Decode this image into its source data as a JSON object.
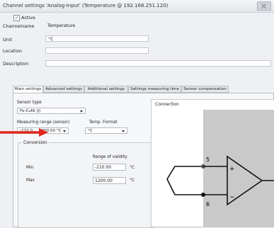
{
  "window": {
    "title": "Channel settings 'Analog-Input' (Temperature @ 192.168.251.120)",
    "active_label": "Active",
    "active_checked": true
  },
  "fields": {
    "channel_name_label": "Channelname",
    "channel_name_value": "Temperature",
    "unit_label": "Unit",
    "unit_value": "°C",
    "location_label": "Location",
    "location_value": "",
    "description_label": "Description",
    "description_value": ""
  },
  "tabs": [
    {
      "label": "Main settings",
      "active": true
    },
    {
      "label": "Advanced settings",
      "active": false
    },
    {
      "label": "Additional settings",
      "active": false
    },
    {
      "label": "Settings measuring time",
      "active": false
    },
    {
      "label": "Sensor compensation",
      "active": false
    }
  ],
  "main": {
    "sensor_type_label": "Sensor type",
    "sensor_type_value": "Fe-CuNi (J)",
    "range_label": "Measuring range (sensor)",
    "range_value": "-210.0 ... 1200.00 °C",
    "temp_format_label": "Temp. Format",
    "temp_format_value": "°C",
    "conversion_title": "Conversion",
    "range_validity_label": "Range of validity",
    "min_label": "Min",
    "min_value": "-210.00",
    "min_unit": "°C",
    "max_label": "Max",
    "max_value": "1200.00",
    "max_unit": "°C"
  },
  "connection": {
    "title": "Connection",
    "terminal_top": "5",
    "terminal_bottom": "6",
    "plus_sign": "+",
    "minus_sign": "−"
  },
  "colors": {
    "arrow": "#e0281e",
    "diagram_gray": "#c9c9c9"
  }
}
